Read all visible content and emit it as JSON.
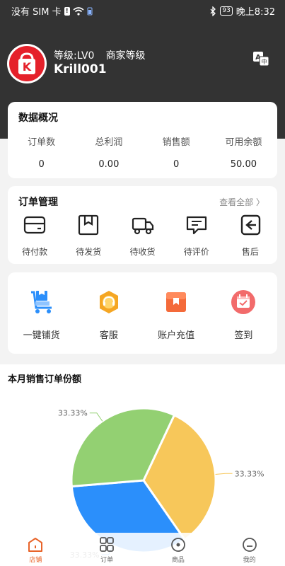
{
  "status_bar": {
    "left_text": "没有 SIM 卡",
    "sim_badge": "!",
    "battery": "93",
    "time": "晚上8:32"
  },
  "profile": {
    "level": "等级:LV0",
    "merchant_level": "商家等级",
    "username": "Krill001",
    "logo_letter": "K",
    "lang_icon": "translate-icon"
  },
  "stats": {
    "title": "数据概况",
    "items": [
      {
        "label": "订单数",
        "value": "0"
      },
      {
        "label": "总利润",
        "value": "0.00"
      },
      {
        "label": "销售额",
        "value": "0"
      },
      {
        "label": "可用余额",
        "value": "50.00"
      }
    ]
  },
  "orders": {
    "title": "订单管理",
    "view_all": "查看全部 〉",
    "items": [
      {
        "label": "待付款",
        "icon": "wallet-icon"
      },
      {
        "label": "待发货",
        "icon": "package-icon"
      },
      {
        "label": "待收货",
        "icon": "truck-icon"
      },
      {
        "label": "待评价",
        "icon": "comment-icon"
      },
      {
        "label": "售后",
        "icon": "return-icon"
      }
    ]
  },
  "tools": {
    "items": [
      {
        "label": "一键铺货",
        "icon": "cart-icon"
      },
      {
        "label": "客服",
        "icon": "headset-icon"
      },
      {
        "label": "账户充值",
        "icon": "recharge-icon"
      },
      {
        "label": "签到",
        "icon": "calendar-check-icon"
      }
    ]
  },
  "sales_chart": {
    "title": "本月销售订单份额"
  },
  "chart_data": {
    "type": "pie",
    "title": "本月销售订单份额",
    "slices": [
      {
        "label": "33.33%",
        "value": 33.33,
        "color": "#f7c75a"
      },
      {
        "label": "33.33%",
        "value": 33.33,
        "color": "#2b8ffb"
      },
      {
        "label": "33.33%",
        "value": 33.33,
        "color": "#93d072"
      }
    ]
  },
  "tabbar": {
    "items": [
      {
        "label": "店铺",
        "active": true
      },
      {
        "label": "订单",
        "active": false
      },
      {
        "label": "商品",
        "active": false
      },
      {
        "label": "我的",
        "active": false
      }
    ]
  },
  "colors": {
    "header_bg": "#333333",
    "accent": "#e8642a",
    "brand_red": "#e5212b"
  }
}
